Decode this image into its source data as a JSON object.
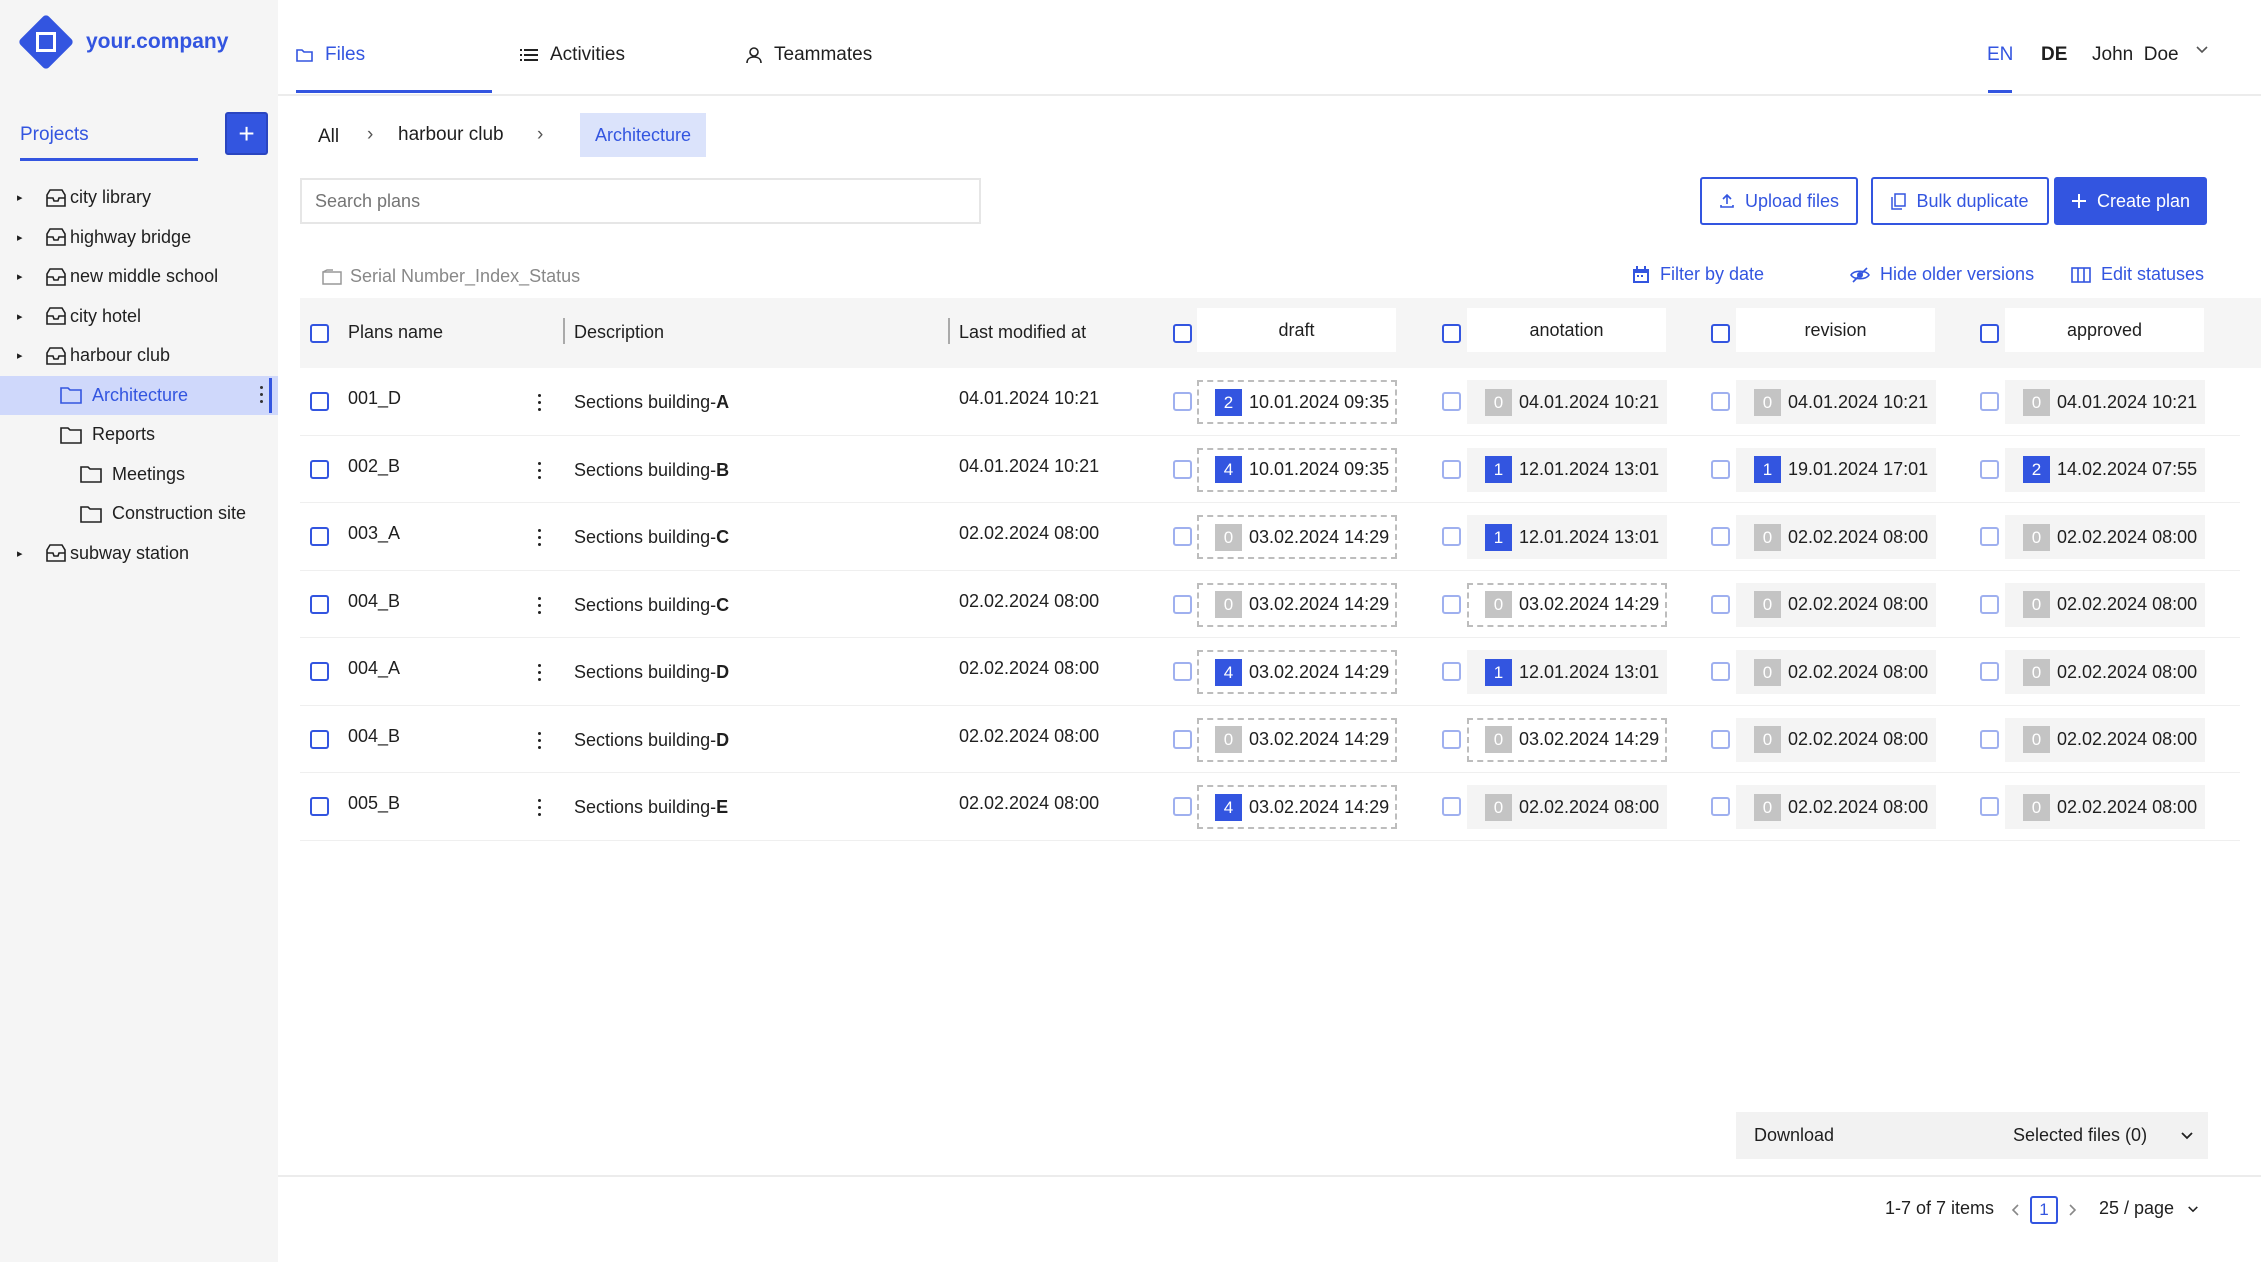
{
  "brand": {
    "name": "your.company",
    "accent": "#3355e0"
  },
  "sidebar": {
    "tab_label": "Projects",
    "add_label": "+",
    "items": [
      {
        "label": "city library",
        "type": "project"
      },
      {
        "label": "highway bridge",
        "type": "project"
      },
      {
        "label": "new middle school",
        "type": "project"
      },
      {
        "label": "city hotel",
        "type": "project"
      },
      {
        "label": "harbour club",
        "type": "project"
      },
      {
        "label": "Architecture",
        "type": "folder",
        "selected": true
      },
      {
        "label": "Reports",
        "type": "folder"
      },
      {
        "label": "Meetings",
        "type": "folder"
      },
      {
        "label": "Construction site",
        "type": "folder"
      },
      {
        "label": "subway station",
        "type": "project"
      }
    ]
  },
  "nav": {
    "tabs": [
      {
        "label": "Files",
        "icon": "folder-icon"
      },
      {
        "label": "Activities",
        "icon": "list-icon"
      },
      {
        "label": "Teammates",
        "icon": "user-icon"
      }
    ],
    "languages": [
      "EN",
      "DE"
    ],
    "user_first": "John",
    "user_last": "Doe"
  },
  "breadcrumb": {
    "all": "All",
    "project": "harbour club",
    "current": "Architecture",
    "sep": "›"
  },
  "search": {
    "placeholder": "Search plans"
  },
  "actions": {
    "upload": "Upload files",
    "bulk": "Bulk duplicate",
    "create": "Create plan"
  },
  "toolbar": {
    "serial": "Serial Number_Index_Status",
    "filter": "Filter by date",
    "hide": "Hide older versions",
    "edit": "Edit statuses"
  },
  "table": {
    "headers": {
      "name": "Plans name",
      "description": "Description",
      "modified": "Last modified at"
    },
    "statuses": [
      "draft",
      "anotation",
      "revision",
      "approved"
    ],
    "rows": [
      {
        "name": "001_D",
        "desc": "Sections building-",
        "desc_suffix": "A",
        "modified": "04.01.2024 10:21",
        "cells": [
          {
            "n": "2",
            "d": "10.01.2024 09:35",
            "active": true,
            "dashed": true
          },
          {
            "n": "0",
            "d": "04.01.2024 10:21"
          },
          {
            "n": "0",
            "d": "04.01.2024 10:21"
          },
          {
            "n": "0",
            "d": "04.01.2024 10:21"
          }
        ]
      },
      {
        "name": "002_B",
        "desc": "Sections building-",
        "desc_suffix": "B",
        "modified": "04.01.2024 10:21",
        "cells": [
          {
            "n": "4",
            "d": "10.01.2024 09:35",
            "active": true,
            "dashed": true
          },
          {
            "n": "1",
            "d": "12.01.2024 13:01",
            "active": true
          },
          {
            "n": "1",
            "d": "19.01.2024 17:01",
            "active": true
          },
          {
            "n": "2",
            "d": "14.02.2024 07:55",
            "active": true
          }
        ]
      },
      {
        "name": "003_A",
        "desc": "Sections building-",
        "desc_suffix": "C",
        "modified": "02.02.2024 08:00",
        "cells": [
          {
            "n": "0",
            "d": "03.02.2024 14:29",
            "dashed": true
          },
          {
            "n": "1",
            "d": "12.01.2024 13:01",
            "active": true
          },
          {
            "n": "0",
            "d": "02.02.2024 08:00"
          },
          {
            "n": "0",
            "d": "02.02.2024 08:00"
          }
        ]
      },
      {
        "name": "004_B",
        "desc": "Sections building-",
        "desc_suffix": "C",
        "modified": "02.02.2024 08:00",
        "cells": [
          {
            "n": "0",
            "d": "03.02.2024 14:29",
            "dashed": true
          },
          {
            "n": "0",
            "d": "03.02.2024 14:29",
            "dashed": true
          },
          {
            "n": "0",
            "d": "02.02.2024 08:00"
          },
          {
            "n": "0",
            "d": "02.02.2024 08:00"
          }
        ]
      },
      {
        "name": "004_A",
        "desc": "Sections building-",
        "desc_suffix": "D",
        "modified": "02.02.2024 08:00",
        "cells": [
          {
            "n": "4",
            "d": "03.02.2024 14:29",
            "active": true,
            "dashed": true
          },
          {
            "n": "1",
            "d": "12.01.2024 13:01",
            "active": true
          },
          {
            "n": "0",
            "d": "02.02.2024 08:00"
          },
          {
            "n": "0",
            "d": "02.02.2024 08:00"
          }
        ]
      },
      {
        "name": "004_B",
        "desc": "Sections building-",
        "desc_suffix": "D",
        "modified": "02.02.2024 08:00",
        "cells": [
          {
            "n": "0",
            "d": "03.02.2024 14:29",
            "dashed": true
          },
          {
            "n": "0",
            "d": "03.02.2024 14:29",
            "dashed": true
          },
          {
            "n": "0",
            "d": "02.02.2024 08:00"
          },
          {
            "n": "0",
            "d": "02.02.2024 08:00"
          }
        ]
      },
      {
        "name": "005_B",
        "desc": "Sections building-",
        "desc_suffix": "E",
        "modified": "02.02.2024 08:00",
        "cells": [
          {
            "n": "4",
            "d": "03.02.2024 14:29",
            "active": true,
            "dashed": true
          },
          {
            "n": "0",
            "d": "02.02.2024 08:00"
          },
          {
            "n": "0",
            "d": "02.02.2024 08:00"
          },
          {
            "n": "0",
            "d": "02.02.2024 08:00"
          }
        ]
      }
    ]
  },
  "download": {
    "label": "Download",
    "selected": "Selected files (0)"
  },
  "pagination": {
    "summary": "1-7 of 7 items",
    "page": "1",
    "per_page": "25 / page"
  }
}
